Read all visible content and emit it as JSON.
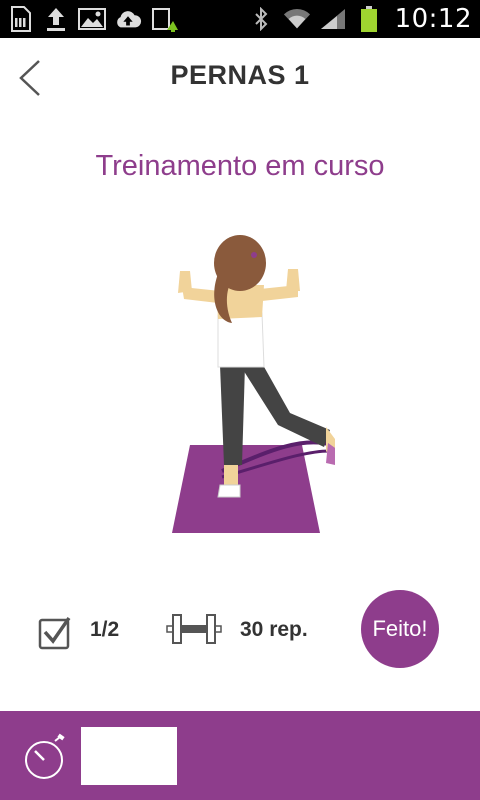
{
  "status_bar": {
    "time": "10:12",
    "left_icons": [
      "sd-card-icon",
      "upload-icon",
      "image-icon",
      "cloud-upload-icon",
      "sync-icon"
    ],
    "right_icons": [
      "bluetooth-icon",
      "wifi-icon",
      "signal-icon",
      "battery-icon"
    ],
    "battery_color": "#9fd430"
  },
  "header": {
    "title": "PERNAS 1",
    "back_icon": "chevron-left-icon"
  },
  "workout": {
    "status_title": "Treinamento em curso",
    "illustration": "exercise-illustration",
    "sets": "1/2",
    "reps": "30 rep.",
    "done_label": "Feito!"
  },
  "bottom_bar": {
    "timer_icon": "stopwatch-icon",
    "timer_value": ""
  },
  "colors": {
    "accent": "#8e3d8c",
    "mat": "#8e3d8c",
    "text_dark": "#333333"
  }
}
